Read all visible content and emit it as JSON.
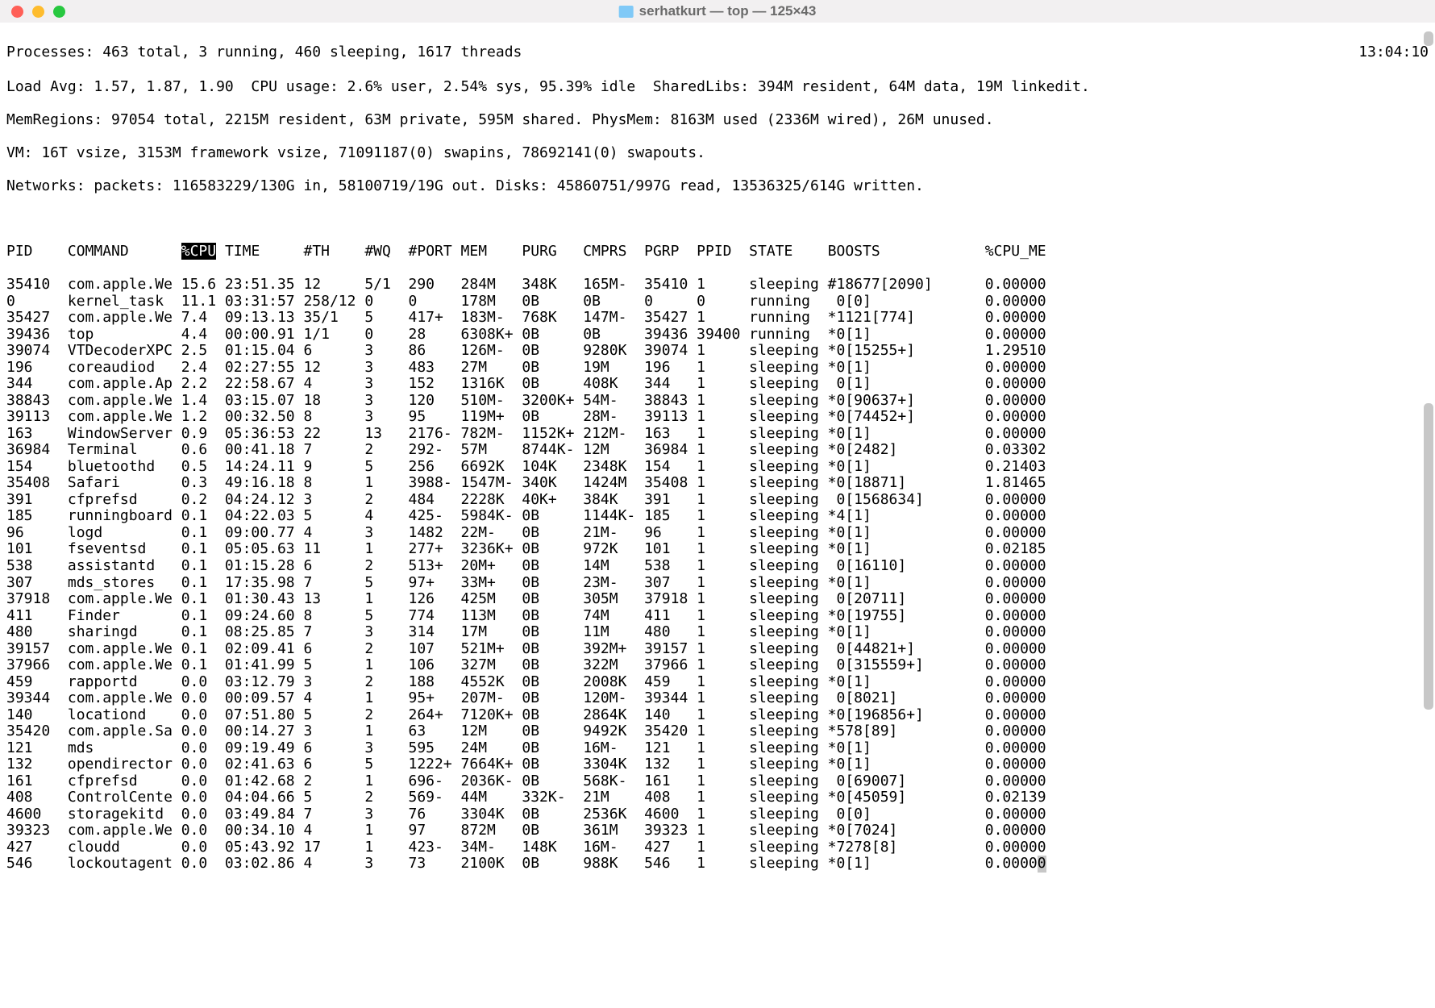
{
  "window": {
    "title": "serhatkurt — top — 125×43"
  },
  "clock": "13:04:10",
  "summary": {
    "l1": "Processes: 463 total, 3 running, 460 sleeping, 1617 threads",
    "l2": "Load Avg: 1.57, 1.87, 1.90  CPU usage: 2.6% user, 2.54% sys, 95.39% idle  SharedLibs: 394M resident, 64M data, 19M linkedit.",
    "l3": "MemRegions: 97054 total, 2215M resident, 63M private, 595M shared. PhysMem: 8163M used (2336M wired), 26M unused.",
    "l4": "VM: 16T vsize, 3153M framework vsize, 71091187(0) swapins, 78692141(0) swapouts.",
    "l5": "Networks: packets: 116583229/130G in, 58100719/19G out. Disks: 45860751/997G read, 13536325/614G written."
  },
  "columns": [
    "PID",
    "COMMAND",
    "%CPU",
    "TIME",
    "#TH",
    "#WQ",
    "#PORT",
    "MEM",
    "PURG",
    "CMPRS",
    "PGRP",
    "PPID",
    "STATE",
    "BOOSTS",
    "%CPU_ME"
  ],
  "sort_column": "%CPU",
  "rows": [
    {
      "pid": "35410",
      "cmd": "com.apple.We",
      "cpu": "15.6",
      "time": "23:51.35",
      "th": "12",
      "wq": "5/1",
      "port": "290",
      "mem": "284M",
      "purg": "348K",
      "cmprs": "165M-",
      "pgrp": "35410",
      "ppid": "1",
      "state": "sleeping",
      "boosts": "#18677[2090]",
      "cpume": "0.00000"
    },
    {
      "pid": "0",
      "cmd": "kernel_task",
      "cpu": "11.1",
      "time": "03:31:57",
      "th": "258/12",
      "wq": "0",
      "port": "0",
      "mem": "178M",
      "purg": "0B",
      "cmprs": "0B",
      "pgrp": "0",
      "ppid": "0",
      "state": "running",
      "boosts": " 0[0]",
      "cpume": "0.00000"
    },
    {
      "pid": "35427",
      "cmd": "com.apple.We",
      "cpu": "7.4",
      "time": "09:13.13",
      "th": "35/1",
      "wq": "5",
      "port": "417+",
      "mem": "183M-",
      "purg": "768K",
      "cmprs": "147M-",
      "pgrp": "35427",
      "ppid": "1",
      "state": "running",
      "boosts": "*1121[774]",
      "cpume": "0.00000"
    },
    {
      "pid": "39436",
      "cmd": "top",
      "cpu": "4.4",
      "time": "00:00.91",
      "th": "1/1",
      "wq": "0",
      "port": "28",
      "mem": "6308K+",
      "purg": "0B",
      "cmprs": "0B",
      "pgrp": "39436",
      "ppid": "39400",
      "state": "running",
      "boosts": "*0[1]",
      "cpume": "0.00000"
    },
    {
      "pid": "39074",
      "cmd": "VTDecoderXPC",
      "cpu": "2.5",
      "time": "01:15.04",
      "th": "6",
      "wq": "3",
      "port": "86",
      "mem": "126M-",
      "purg": "0B",
      "cmprs": "9280K",
      "pgrp": "39074",
      "ppid": "1",
      "state": "sleeping",
      "boosts": "*0[15255+]",
      "cpume": "1.29510"
    },
    {
      "pid": "196",
      "cmd": "coreaudiod",
      "cpu": "2.4",
      "time": "02:27:55",
      "th": "12",
      "wq": "3",
      "port": "483",
      "mem": "27M",
      "purg": "0B",
      "cmprs": "19M",
      "pgrp": "196",
      "ppid": "1",
      "state": "sleeping",
      "boosts": "*0[1]",
      "cpume": "0.00000"
    },
    {
      "pid": "344",
      "cmd": "com.apple.Ap",
      "cpu": "2.2",
      "time": "22:58.67",
      "th": "4",
      "wq": "3",
      "port": "152",
      "mem": "1316K",
      "purg": "0B",
      "cmprs": "408K",
      "pgrp": "344",
      "ppid": "1",
      "state": "sleeping",
      "boosts": " 0[1]",
      "cpume": "0.00000"
    },
    {
      "pid": "38843",
      "cmd": "com.apple.We",
      "cpu": "1.4",
      "time": "03:15.07",
      "th": "18",
      "wq": "3",
      "port": "120",
      "mem": "510M-",
      "purg": "3200K+",
      "cmprs": "54M-",
      "pgrp": "38843",
      "ppid": "1",
      "state": "sleeping",
      "boosts": "*0[90637+]",
      "cpume": "0.00000"
    },
    {
      "pid": "39113",
      "cmd": "com.apple.We",
      "cpu": "1.2",
      "time": "00:32.50",
      "th": "8",
      "wq": "3",
      "port": "95",
      "mem": "119M+",
      "purg": "0B",
      "cmprs": "28M-",
      "pgrp": "39113",
      "ppid": "1",
      "state": "sleeping",
      "boosts": "*0[74452+]",
      "cpume": "0.00000"
    },
    {
      "pid": "163",
      "cmd": "WindowServer",
      "cpu": "0.9",
      "time": "05:36:53",
      "th": "22",
      "wq": "13",
      "port": "2176-",
      "mem": "782M-",
      "purg": "1152K+",
      "cmprs": "212M-",
      "pgrp": "163",
      "ppid": "1",
      "state": "sleeping",
      "boosts": "*0[1]",
      "cpume": "0.00000"
    },
    {
      "pid": "36984",
      "cmd": "Terminal",
      "cpu": "0.6",
      "time": "00:41.18",
      "th": "7",
      "wq": "2",
      "port": "292-",
      "mem": "57M",
      "purg": "8744K-",
      "cmprs": "12M",
      "pgrp": "36984",
      "ppid": "1",
      "state": "sleeping",
      "boosts": "*0[2482]",
      "cpume": "0.03302"
    },
    {
      "pid": "154",
      "cmd": "bluetoothd",
      "cpu": "0.5",
      "time": "14:24.11",
      "th": "9",
      "wq": "5",
      "port": "256",
      "mem": "6692K",
      "purg": "104K",
      "cmprs": "2348K",
      "pgrp": "154",
      "ppid": "1",
      "state": "sleeping",
      "boosts": "*0[1]",
      "cpume": "0.21403"
    },
    {
      "pid": "35408",
      "cmd": "Safari",
      "cpu": "0.3",
      "time": "49:16.18",
      "th": "8",
      "wq": "1",
      "port": "3988-",
      "mem": "1547M-",
      "purg": "340K",
      "cmprs": "1424M",
      "pgrp": "35408",
      "ppid": "1",
      "state": "sleeping",
      "boosts": "*0[18871]",
      "cpume": "1.81465"
    },
    {
      "pid": "391",
      "cmd": "cfprefsd",
      "cpu": "0.2",
      "time": "04:24.12",
      "th": "3",
      "wq": "2",
      "port": "484",
      "mem": "2228K",
      "purg": "40K+",
      "cmprs": "384K",
      "pgrp": "391",
      "ppid": "1",
      "state": "sleeping",
      "boosts": " 0[1568634]",
      "cpume": "0.00000"
    },
    {
      "pid": "185",
      "cmd": "runningboard",
      "cpu": "0.1",
      "time": "04:22.03",
      "th": "5",
      "wq": "4",
      "port": "425-",
      "mem": "5984K-",
      "purg": "0B",
      "cmprs": "1144K-",
      "pgrp": "185",
      "ppid": "1",
      "state": "sleeping",
      "boosts": "*4[1]",
      "cpume": "0.00000"
    },
    {
      "pid": "96",
      "cmd": "logd",
      "cpu": "0.1",
      "time": "09:00.77",
      "th": "4",
      "wq": "3",
      "port": "1482",
      "mem": "22M-",
      "purg": "0B",
      "cmprs": "21M-",
      "pgrp": "96",
      "ppid": "1",
      "state": "sleeping",
      "boosts": "*0[1]",
      "cpume": "0.00000"
    },
    {
      "pid": "101",
      "cmd": "fseventsd",
      "cpu": "0.1",
      "time": "05:05.63",
      "th": "11",
      "wq": "1",
      "port": "277+",
      "mem": "3236K+",
      "purg": "0B",
      "cmprs": "972K",
      "pgrp": "101",
      "ppid": "1",
      "state": "sleeping",
      "boosts": "*0[1]",
      "cpume": "0.02185"
    },
    {
      "pid": "538",
      "cmd": "assistantd",
      "cpu": "0.1",
      "time": "01:15.28",
      "th": "6",
      "wq": "2",
      "port": "513+",
      "mem": "20M+",
      "purg": "0B",
      "cmprs": "14M",
      "pgrp": "538",
      "ppid": "1",
      "state": "sleeping",
      "boosts": " 0[16110]",
      "cpume": "0.00000"
    },
    {
      "pid": "307",
      "cmd": "mds_stores",
      "cpu": "0.1",
      "time": "17:35.98",
      "th": "7",
      "wq": "5",
      "port": "97+",
      "mem": "33M+",
      "purg": "0B",
      "cmprs": "23M-",
      "pgrp": "307",
      "ppid": "1",
      "state": "sleeping",
      "boosts": "*0[1]",
      "cpume": "0.00000"
    },
    {
      "pid": "37918",
      "cmd": "com.apple.We",
      "cpu": "0.1",
      "time": "01:30.43",
      "th": "13",
      "wq": "1",
      "port": "126",
      "mem": "425M",
      "purg": "0B",
      "cmprs": "305M",
      "pgrp": "37918",
      "ppid": "1",
      "state": "sleeping",
      "boosts": " 0[20711]",
      "cpume": "0.00000"
    },
    {
      "pid": "411",
      "cmd": "Finder",
      "cpu": "0.1",
      "time": "09:24.60",
      "th": "8",
      "wq": "5",
      "port": "774",
      "mem": "113M",
      "purg": "0B",
      "cmprs": "74M",
      "pgrp": "411",
      "ppid": "1",
      "state": "sleeping",
      "boosts": "*0[19755]",
      "cpume": "0.00000"
    },
    {
      "pid": "480",
      "cmd": "sharingd",
      "cpu": "0.1",
      "time": "08:25.85",
      "th": "7",
      "wq": "3",
      "port": "314",
      "mem": "17M",
      "purg": "0B",
      "cmprs": "11M",
      "pgrp": "480",
      "ppid": "1",
      "state": "sleeping",
      "boosts": "*0[1]",
      "cpume": "0.00000"
    },
    {
      "pid": "39157",
      "cmd": "com.apple.We",
      "cpu": "0.1",
      "time": "02:09.41",
      "th": "6",
      "wq": "2",
      "port": "107",
      "mem": "521M+",
      "purg": "0B",
      "cmprs": "392M+",
      "pgrp": "39157",
      "ppid": "1",
      "state": "sleeping",
      "boosts": " 0[44821+]",
      "cpume": "0.00000"
    },
    {
      "pid": "37966",
      "cmd": "com.apple.We",
      "cpu": "0.1",
      "time": "01:41.99",
      "th": "5",
      "wq": "1",
      "port": "106",
      "mem": "327M",
      "purg": "0B",
      "cmprs": "322M",
      "pgrp": "37966",
      "ppid": "1",
      "state": "sleeping",
      "boosts": " 0[315559+]",
      "cpume": "0.00000"
    },
    {
      "pid": "459",
      "cmd": "rapportd",
      "cpu": "0.0",
      "time": "03:12.79",
      "th": "3",
      "wq": "2",
      "port": "188",
      "mem": "4552K",
      "purg": "0B",
      "cmprs": "2008K",
      "pgrp": "459",
      "ppid": "1",
      "state": "sleeping",
      "boosts": "*0[1]",
      "cpume": "0.00000"
    },
    {
      "pid": "39344",
      "cmd": "com.apple.We",
      "cpu": "0.0",
      "time": "00:09.57",
      "th": "4",
      "wq": "1",
      "port": "95+",
      "mem": "207M-",
      "purg": "0B",
      "cmprs": "120M-",
      "pgrp": "39344",
      "ppid": "1",
      "state": "sleeping",
      "boosts": " 0[8021]",
      "cpume": "0.00000"
    },
    {
      "pid": "140",
      "cmd": "locationd",
      "cpu": "0.0",
      "time": "07:51.80",
      "th": "5",
      "wq": "2",
      "port": "264+",
      "mem": "7120K+",
      "purg": "0B",
      "cmprs": "2864K",
      "pgrp": "140",
      "ppid": "1",
      "state": "sleeping",
      "boosts": "*0[196856+]",
      "cpume": "0.00000"
    },
    {
      "pid": "35420",
      "cmd": "com.apple.Sa",
      "cpu": "0.0",
      "time": "00:14.27",
      "th": "3",
      "wq": "1",
      "port": "63",
      "mem": "12M",
      "purg": "0B",
      "cmprs": "9492K",
      "pgrp": "35420",
      "ppid": "1",
      "state": "sleeping",
      "boosts": "*578[89]",
      "cpume": "0.00000"
    },
    {
      "pid": "121",
      "cmd": "mds",
      "cpu": "0.0",
      "time": "09:19.49",
      "th": "6",
      "wq": "3",
      "port": "595",
      "mem": "24M",
      "purg": "0B",
      "cmprs": "16M-",
      "pgrp": "121",
      "ppid": "1",
      "state": "sleeping",
      "boosts": "*0[1]",
      "cpume": "0.00000"
    },
    {
      "pid": "132",
      "cmd": "opendirector",
      "cpu": "0.0",
      "time": "02:41.63",
      "th": "6",
      "wq": "5",
      "port": "1222+",
      "mem": "7664K+",
      "purg": "0B",
      "cmprs": "3304K",
      "pgrp": "132",
      "ppid": "1",
      "state": "sleeping",
      "boosts": "*0[1]",
      "cpume": "0.00000"
    },
    {
      "pid": "161",
      "cmd": "cfprefsd",
      "cpu": "0.0",
      "time": "01:42.68",
      "th": "2",
      "wq": "1",
      "port": "696-",
      "mem": "2036K-",
      "purg": "0B",
      "cmprs": "568K-",
      "pgrp": "161",
      "ppid": "1",
      "state": "sleeping",
      "boosts": " 0[69007]",
      "cpume": "0.00000"
    },
    {
      "pid": "408",
      "cmd": "ControlCente",
      "cpu": "0.0",
      "time": "04:04.66",
      "th": "5",
      "wq": "2",
      "port": "569-",
      "mem": "44M",
      "purg": "332K-",
      "cmprs": "21M",
      "pgrp": "408",
      "ppid": "1",
      "state": "sleeping",
      "boosts": "*0[45059]",
      "cpume": "0.02139"
    },
    {
      "pid": "4600",
      "cmd": "storagekitd",
      "cpu": "0.0",
      "time": "03:49.84",
      "th": "7",
      "wq": "3",
      "port": "76",
      "mem": "3304K",
      "purg": "0B",
      "cmprs": "2536K",
      "pgrp": "4600",
      "ppid": "1",
      "state": "sleeping",
      "boosts": " 0[0]",
      "cpume": "0.00000"
    },
    {
      "pid": "39323",
      "cmd": "com.apple.We",
      "cpu": "0.0",
      "time": "00:34.10",
      "th": "4",
      "wq": "1",
      "port": "97",
      "mem": "872M",
      "purg": "0B",
      "cmprs": "361M",
      "pgrp": "39323",
      "ppid": "1",
      "state": "sleeping",
      "boosts": "*0[7024]",
      "cpume": "0.00000"
    },
    {
      "pid": "427",
      "cmd": "cloudd",
      "cpu": "0.0",
      "time": "05:43.92",
      "th": "17",
      "wq": "1",
      "port": "423-",
      "mem": "34M-",
      "purg": "148K",
      "cmprs": "16M-",
      "pgrp": "427",
      "ppid": "1",
      "state": "sleeping",
      "boosts": "*7278[8]",
      "cpume": "0.00000"
    },
    {
      "pid": "546",
      "cmd": "lockoutagent",
      "cpu": "0.0",
      "time": "03:02.86",
      "th": "4",
      "wq": "3",
      "port": "73",
      "mem": "2100K",
      "purg": "0B",
      "cmprs": "988K",
      "pgrp": "546",
      "ppid": "1",
      "state": "sleeping",
      "boosts": "*0[1]",
      "cpume": "0.0000"
    }
  ]
}
